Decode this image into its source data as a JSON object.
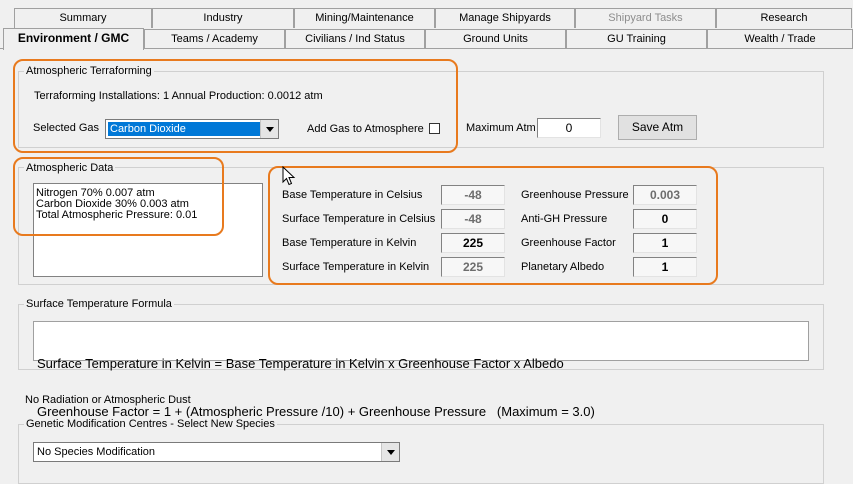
{
  "tabs_row1": [
    "Summary",
    "Industry",
    "Mining/Maintenance",
    "Manage Shipyards",
    "Shipyard Tasks",
    "Research"
  ],
  "tabs_row2": [
    "Environment / GMC",
    "Teams / Academy",
    "Civilians / Ind Status",
    "Ground Units",
    "GU Training",
    "Wealth / Trade"
  ],
  "terraforming": {
    "title": "Atmospheric Terraforming",
    "installations": "Terraforming Installations: 1   Annual Production: 0.0012 atm",
    "selected_gas_label": "Selected Gas",
    "selected_gas_value": "Carbon Dioxide",
    "add_gas_label": "Add Gas to Atmosphere",
    "max_atm_label": "Maximum Atm",
    "max_atm_value": "0",
    "save_button": "Save Atm"
  },
  "atmosphere": {
    "title": "Atmospheric Data",
    "lines": [
      "Nitrogen 70%   0.007 atm",
      "Carbon Dioxide 30%   0.003 atm",
      "Total Atmospheric Pressure: 0.01"
    ],
    "base_c_label": "Base Temperature in Celsius",
    "base_c": "-48",
    "surf_c_label": "Surface Temperature in Celsius",
    "surf_c": "-48",
    "base_k_label": "Base Temperature in Kelvin",
    "base_k": "225",
    "surf_k_label": "Surface Temperature in Kelvin",
    "surf_k": "225",
    "gh_pressure_label": "Greenhouse Pressure",
    "gh_pressure": "0.003",
    "anti_gh_label": "Anti-GH Pressure",
    "anti_gh": "0",
    "gh_factor_label": "Greenhouse Factor",
    "gh_factor": "1",
    "albedo_label": "Planetary Albedo",
    "albedo": "1"
  },
  "formula": {
    "title": "Surface Temperature Formula",
    "line1": "Surface Temperature in Kelvin = Base Temperature in Kelvin x Greenhouse Factor x Albedo",
    "line2": "Greenhouse Factor = 1 + (Atmospheric Pressure /10) + Greenhouse Pressure   (Maximum = 3.0)"
  },
  "radiation_text": "No Radiation or Atmospheric Dust",
  "genetic": {
    "title": "Genetic Modification Centres - Select New Species",
    "value": "No Species Modification"
  },
  "colors": {
    "highlight": "#e87a1e",
    "selection": "#0078d7"
  }
}
